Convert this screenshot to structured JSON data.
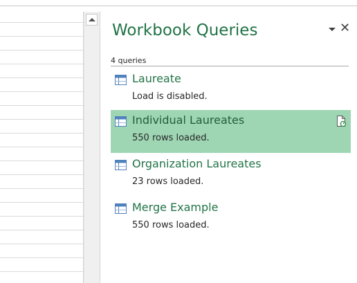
{
  "pane": {
    "title": "Workbook Queries",
    "menu_icon": "chevron-down-icon",
    "close_glyph": "✕",
    "count_label": "4 queries"
  },
  "queries": [
    {
      "name": "Laureate",
      "status": "Load is disabled.",
      "icon": "table-icon",
      "selected": false
    },
    {
      "name": "Individual Laureates",
      "status": "550 rows loaded.",
      "icon": "table-icon",
      "selected": true
    },
    {
      "name": "Organization Laureates",
      "status": "23 rows loaded.",
      "icon": "table-icon",
      "selected": false
    },
    {
      "name": "Merge Example",
      "status": "550 rows loaded.",
      "icon": "table-icon",
      "selected": false
    }
  ],
  "colors": {
    "accent": "#217346",
    "selected_background": "#9ed6b4",
    "icon_header": "#4f81bd"
  }
}
